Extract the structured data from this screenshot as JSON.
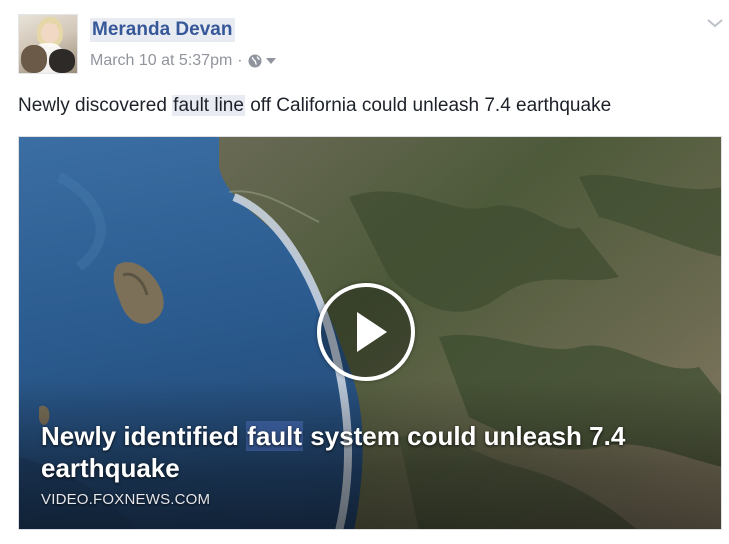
{
  "post": {
    "author": "Meranda Devan",
    "date": "March 10 at 5:37pm",
    "separator": "·",
    "audience_icon": "globe-icon",
    "audience_menu_icon": "caret-down-icon",
    "options_icon": "chevron-down-icon",
    "text_before": "Newly discovered ",
    "text_highlight": "fault line",
    "text_after": " off California could unleash 7.4 earthquake"
  },
  "link_card": {
    "title_before": "Newly identified ",
    "title_highlight": "fault",
    "title_after": " system could unleash 7.4 earthquake",
    "domain": "VIDEO.FOXNEWS.COM",
    "play_icon": "play-icon"
  },
  "colors": {
    "author_link": "#365899",
    "meta_gray": "#90949c",
    "highlight": "#e9ebf3",
    "ocean": "#2b5a8f",
    "land": "#4e5c3a"
  }
}
